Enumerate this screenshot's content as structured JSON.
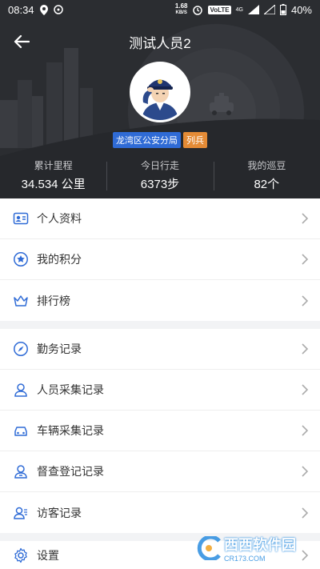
{
  "status_bar": {
    "time": "08:34",
    "speed_value": "1.68",
    "speed_unit": "KB/S",
    "network": "VoLTE",
    "signal": "4G",
    "battery": "40%"
  },
  "nav": {
    "title": "测试人员2"
  },
  "profile": {
    "department": "龙湾区公安分局",
    "rank": "列兵"
  },
  "stats": [
    {
      "label": "累计里程",
      "value": "34.534 公里"
    },
    {
      "label": "今日行走",
      "value": "6373步"
    },
    {
      "label": "我的巡豆",
      "value": "82个"
    }
  ],
  "menu_group_1": [
    {
      "label": "个人资料",
      "icon": "id-card-icon"
    },
    {
      "label": "我的积分",
      "icon": "points-icon"
    },
    {
      "label": "排行榜",
      "icon": "crown-icon"
    }
  ],
  "menu_group_2": [
    {
      "label": "勤务记录",
      "icon": "compass-icon"
    },
    {
      "label": "人员采集记录",
      "icon": "person-icon"
    },
    {
      "label": "车辆采集记录",
      "icon": "car-icon"
    },
    {
      "label": "督查登记记录",
      "icon": "inspector-icon"
    },
    {
      "label": "访客记录",
      "icon": "visitor-icon"
    }
  ],
  "menu_group_3": [
    {
      "label": "设置",
      "icon": "gear-icon"
    }
  ],
  "watermark": {
    "brand": "西西软件园",
    "url": "CR173.COM"
  },
  "colors": {
    "header_bg": "#2b2d31",
    "accent_blue": "#2f6bd6",
    "rank_orange": "#e48b36"
  }
}
